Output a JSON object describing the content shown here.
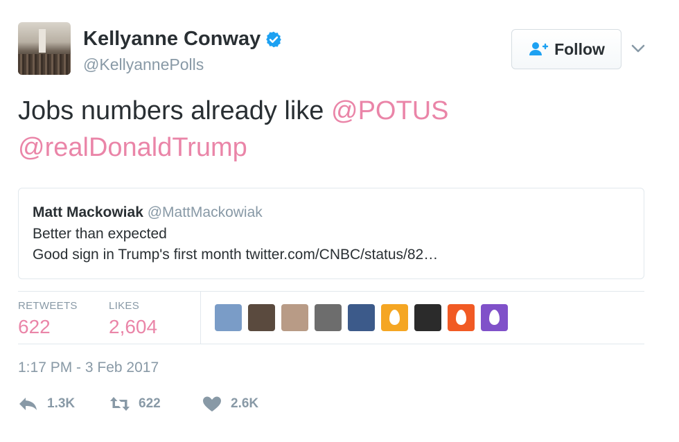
{
  "author": {
    "name": "Kellyanne Conway",
    "handle": "@KellyannePolls",
    "verified": true
  },
  "follow_button": {
    "label": "Follow",
    "icon": "add-user-icon"
  },
  "menu_icon": "chevron-down-icon",
  "tweet": {
    "text_prefix": "Jobs numbers already like ",
    "mentions": [
      "@POTUS",
      "@realDonaldTrump"
    ]
  },
  "quoted_tweet": {
    "name": "Matt Mackowiak",
    "handle": "@MattMackowiak",
    "line1": "Better than expected",
    "line2": "Good sign in Trump's first month twitter.com/CNBC/status/82…"
  },
  "stats": {
    "retweets_label": "RETWEETS",
    "retweets_value": "622",
    "likes_label": "LIKES",
    "likes_value": "2,604"
  },
  "likers": [
    {
      "name": "liker-avatar-flag",
      "color": "#7a9cc7"
    },
    {
      "name": "liker-avatar-photo-2",
      "color": "#5a4a3e"
    },
    {
      "name": "liker-avatar-photo-3",
      "color": "#b89b86"
    },
    {
      "name": "liker-avatar-photo-4",
      "color": "#6d6d6d"
    },
    {
      "name": "liker-avatar-photo-5",
      "color": "#3c5a8a"
    },
    {
      "name": "liker-avatar-egg-yellow",
      "color": "#f5a623",
      "egg": true
    },
    {
      "name": "liker-avatar-photo-7",
      "color": "#2b2b2b"
    },
    {
      "name": "liker-avatar-egg-orange",
      "color": "#f15a24",
      "egg": true
    },
    {
      "name": "liker-avatar-egg-purple",
      "color": "#8051c9",
      "egg": true
    }
  ],
  "timestamp": "1:17 PM - 3 Feb 2017",
  "actions": {
    "reply_count": "1.3K",
    "retweet_count": "622",
    "like_count": "2.6K"
  },
  "colors": {
    "mention": "#ea85a8",
    "muted": "#8899a6",
    "verified": "#1da1f2",
    "border": "#e1e8ed"
  }
}
